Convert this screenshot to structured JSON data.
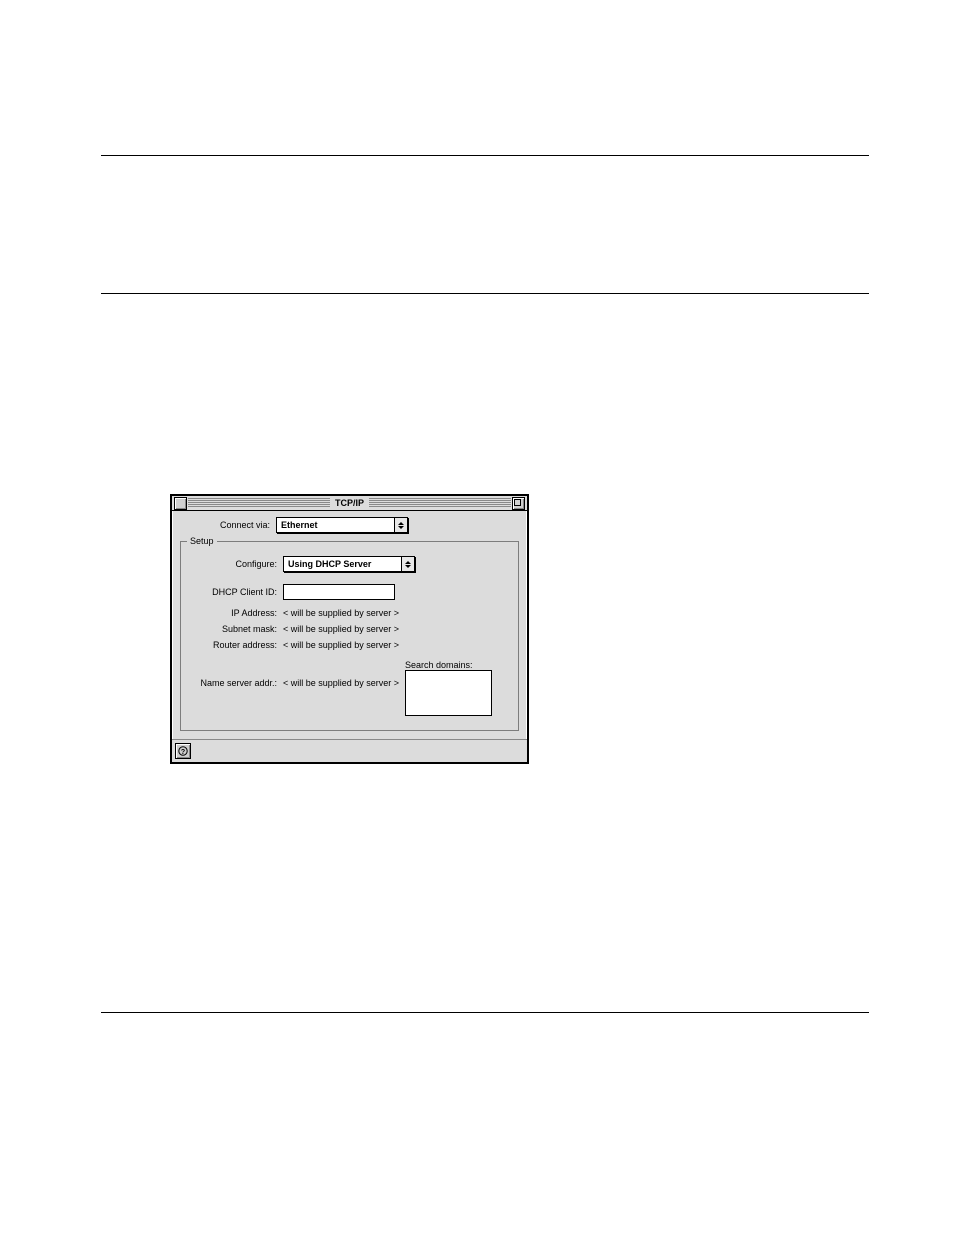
{
  "window": {
    "title": "TCP/IP",
    "connect_via": {
      "label": "Connect via:",
      "value": "Ethernet"
    },
    "setup": {
      "legend": "Setup",
      "configure": {
        "label": "Configure:",
        "value": "Using DHCP Server"
      },
      "dhcp_client_id": {
        "label": "DHCP Client ID:",
        "value": ""
      },
      "ip_address": {
        "label": "IP Address:",
        "value": "< will be supplied by server >"
      },
      "subnet_mask": {
        "label": "Subnet mask:",
        "value": "< will be supplied by server >"
      },
      "router_address": {
        "label": "Router address:",
        "value": "< will be supplied by server >"
      },
      "name_server_addr": {
        "label": "Name server addr.:",
        "value": "< will be supplied by server >"
      },
      "search_domains": {
        "label": "Search domains:",
        "value": ""
      }
    }
  }
}
